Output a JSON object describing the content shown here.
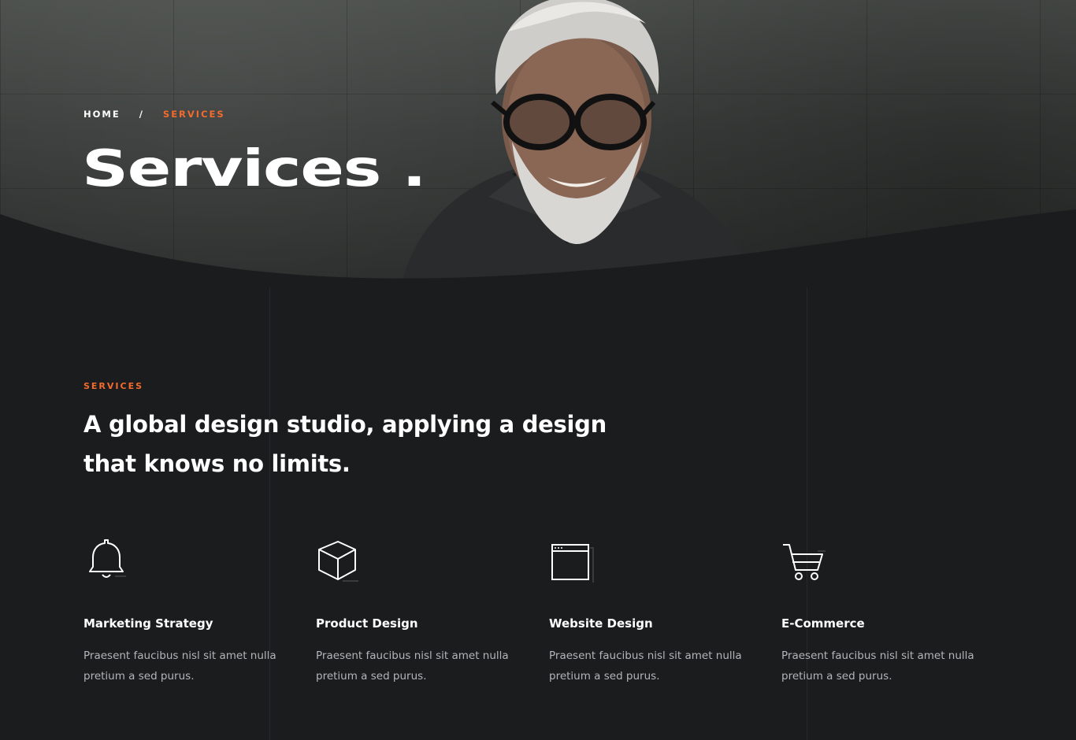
{
  "breadcrumb": {
    "home": "HOME",
    "separator": "/",
    "current": "SERVICES"
  },
  "hero": {
    "title": "Services ."
  },
  "section": {
    "eyebrow": "SERVICES",
    "heading_line1": "A global design studio, applying a design",
    "heading_line2": "that knows no limits."
  },
  "services": [
    {
      "icon": "bell-icon",
      "title": "Marketing Strategy",
      "description": "Praesent faucibus nisl sit amet nulla pretium a sed purus."
    },
    {
      "icon": "cube-icon",
      "title": "Product Design",
      "description": "Praesent faucibus nisl sit amet nulla pretium a sed purus."
    },
    {
      "icon": "browser-window-icon",
      "title": "Website Design",
      "description": "Praesent faucibus nisl sit amet nulla pretium a sed purus."
    },
    {
      "icon": "shopping-cart-icon",
      "title": "E-Commerce",
      "description": "Praesent faucibus nisl sit amet nulla pretium a sed purus."
    }
  ],
  "colors": {
    "accent": "#f26a2e",
    "background": "#1b1c1e",
    "text": "#ffffff",
    "muted": "#b3b5b8"
  }
}
